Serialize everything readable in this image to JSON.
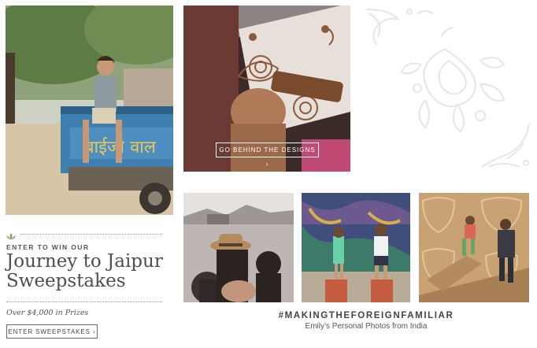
{
  "sweepstakes": {
    "enter_label": "ENTER TO WIN OUR",
    "title": "Journey to Jaipur Sweepstakes",
    "prizes": "Over $4,000 in Prizes",
    "button_label": "ENTER SWEEPSTAKES ›"
  },
  "designs": {
    "button_label": "GO BEHIND THE DESIGNS ›"
  },
  "photos": {
    "truck_sign": "बाईजी वाल"
  },
  "gallery": {
    "hashtag": "#MAKINGTHEFOREIGNFAMILIAR",
    "subtitle": "Emily’s Personal Photos from India"
  },
  "colors": {
    "accent_green": "#8aa35a",
    "truck_blue": "#3f7fb0",
    "text": "#4a4a4a"
  }
}
